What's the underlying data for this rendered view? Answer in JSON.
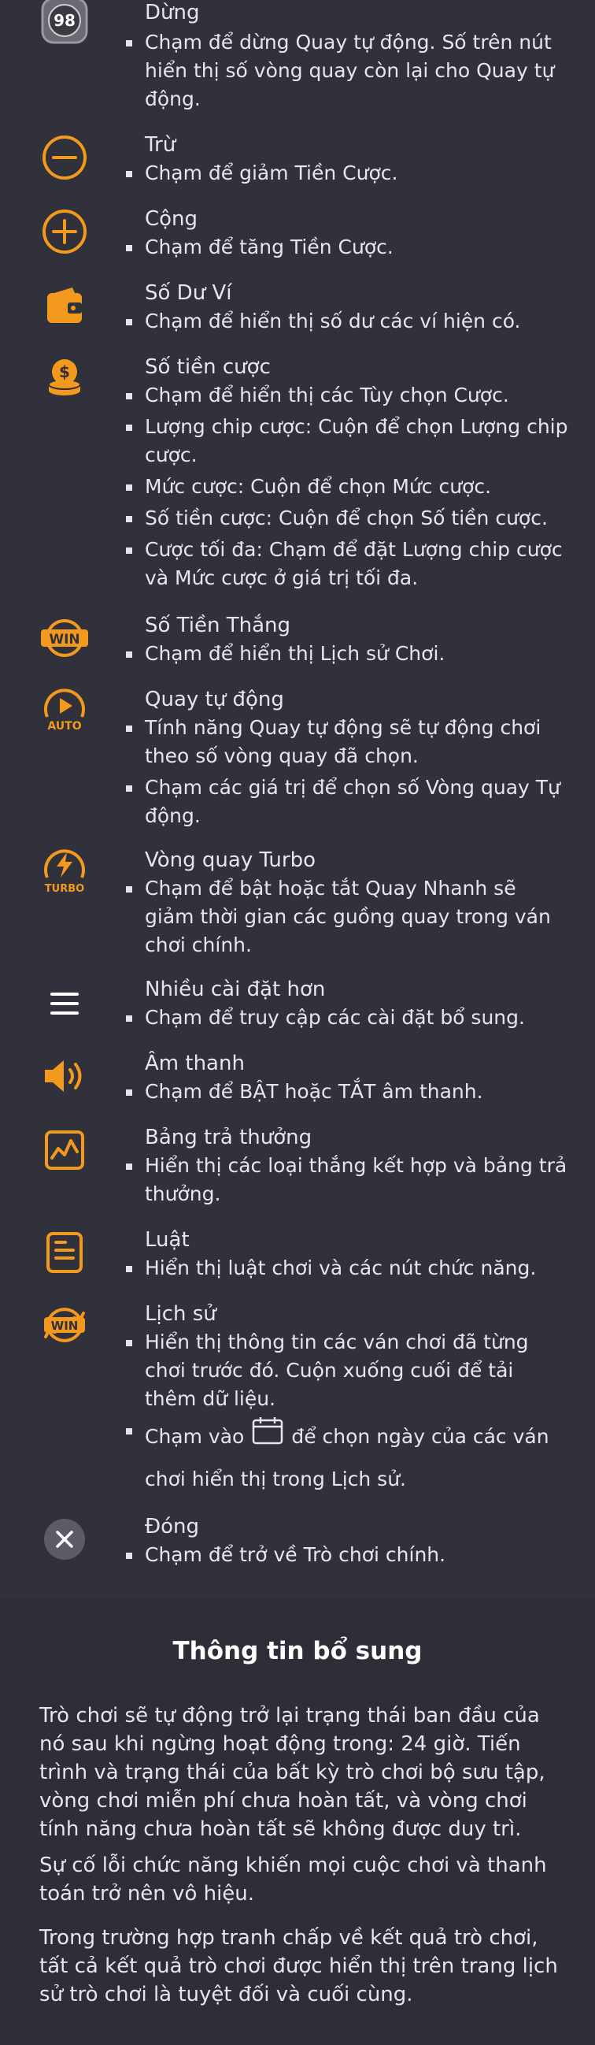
{
  "accent": "#f39a1e",
  "items": [
    {
      "title": "Dừng",
      "icon": "stop-spin-counter-icon",
      "counter": "98",
      "bullets": [
        "Chạm để dừng Quay tự động. Số trên nút hiển thị số vòng quay còn lại cho Quay tự động."
      ]
    },
    {
      "title": "Trừ",
      "icon": "minus-icon",
      "bullets": [
        "Chạm để giảm Tiền Cược."
      ]
    },
    {
      "title": "Cộng",
      "icon": "plus-icon",
      "bullets": [
        "Chạm để tăng Tiền Cược."
      ]
    },
    {
      "title": "Số Dư Ví",
      "icon": "wallet-icon",
      "bullets": [
        "Chạm để hiển thị số dư các ví hiện có."
      ]
    },
    {
      "title": "Số tiền cược",
      "icon": "coins-icon",
      "bullets": [
        "Chạm để hiển thị các Tùy chọn Cược.",
        "Lượng chip cược: Cuộn để chọn Lượng chip cược.",
        "Mức cược: Cuộn để chọn Mức cược.",
        "Số tiền cược: Cuộn để chọn Số tiền cược.",
        "Cược tối đa: Chạm để đặt Lượng chip cược và Mức cược ở giá trị tối đa."
      ]
    },
    {
      "title": "Số Tiền Thắng",
      "icon": "win-icon",
      "icon_text": "WIN",
      "bullets": [
        "Chạm để hiển thị Lịch sử Chơi."
      ]
    },
    {
      "title": "Quay tự động",
      "icon": "auto-spin-icon",
      "icon_text": "AUTO",
      "bullets": [
        "Tính năng Quay tự động sẽ tự động chơi theo số vòng quay đã chọn.",
        "Chạm các giá trị để chọn số Vòng quay Tự động."
      ]
    },
    {
      "title": "Vòng quay Turbo",
      "icon": "turbo-spin-icon",
      "icon_text": "TURBO",
      "bullets": [
        "Chạm để bật hoặc tắt Quay Nhanh sẽ giảm thời gian các guồng quay trong ván chơi chính."
      ]
    },
    {
      "title": "Nhiều cài đặt hơn",
      "icon": "menu-icon",
      "bullets": [
        "Chạm để truy cập các cài đặt bổ sung."
      ]
    },
    {
      "title": "Âm thanh",
      "icon": "sound-icon",
      "bullets": [
        "Chạm để BẬT hoặc TẮT âm thanh."
      ]
    },
    {
      "title": "Bảng trả thưởng",
      "icon": "paytable-icon",
      "bullets": [
        "Hiển thị các loại thắng kết hợp và bảng trả thưởng."
      ]
    },
    {
      "title": "Luật",
      "icon": "rules-icon",
      "bullets": [
        "Hiển thị luật chơi và các nút chức năng."
      ]
    },
    {
      "title": "Lịch sử",
      "icon": "history-icon",
      "icon_text": "WIN",
      "bullets": [
        "Hiển thị thông tin các ván chơi đã từng chơi trước đó. Cuộn xuống cuối để tải thêm dữ liệu."
      ],
      "calendar_bullet": {
        "before": "Chạm vào",
        "after": "để chọn ngày của các ván",
        "line2": "chơi hiển thị trong Lịch sử."
      }
    },
    {
      "title": "Đóng",
      "icon": "close-icon",
      "bullets": [
        "Chạm để trở về Trò chơi chính."
      ]
    }
  ],
  "extra": {
    "heading": "Thông tin bổ sung",
    "paragraphs": [
      "Trò chơi sẽ tự động trở lại trạng thái ban đầu của nó sau khi ngừng hoạt động trong: 24 giờ. Tiến trình và trạng thái của bất kỳ trò chơi bộ sưu tập, vòng chơi miễn phí chưa hoàn tất, và vòng chơi tính năng chưa hoàn tất sẽ không được duy trì.",
      "Sự cố lỗi chức năng khiến mọi cuộc chơi và thanh toán trở nên vô hiệu.",
      "Trong trường hợp tranh chấp về kết quả trò chơi, tất cả kết quả trò chơi được hiển thị trên trang lịch sử trò chơi là tuyệt đối và cuối cùng."
    ]
  }
}
